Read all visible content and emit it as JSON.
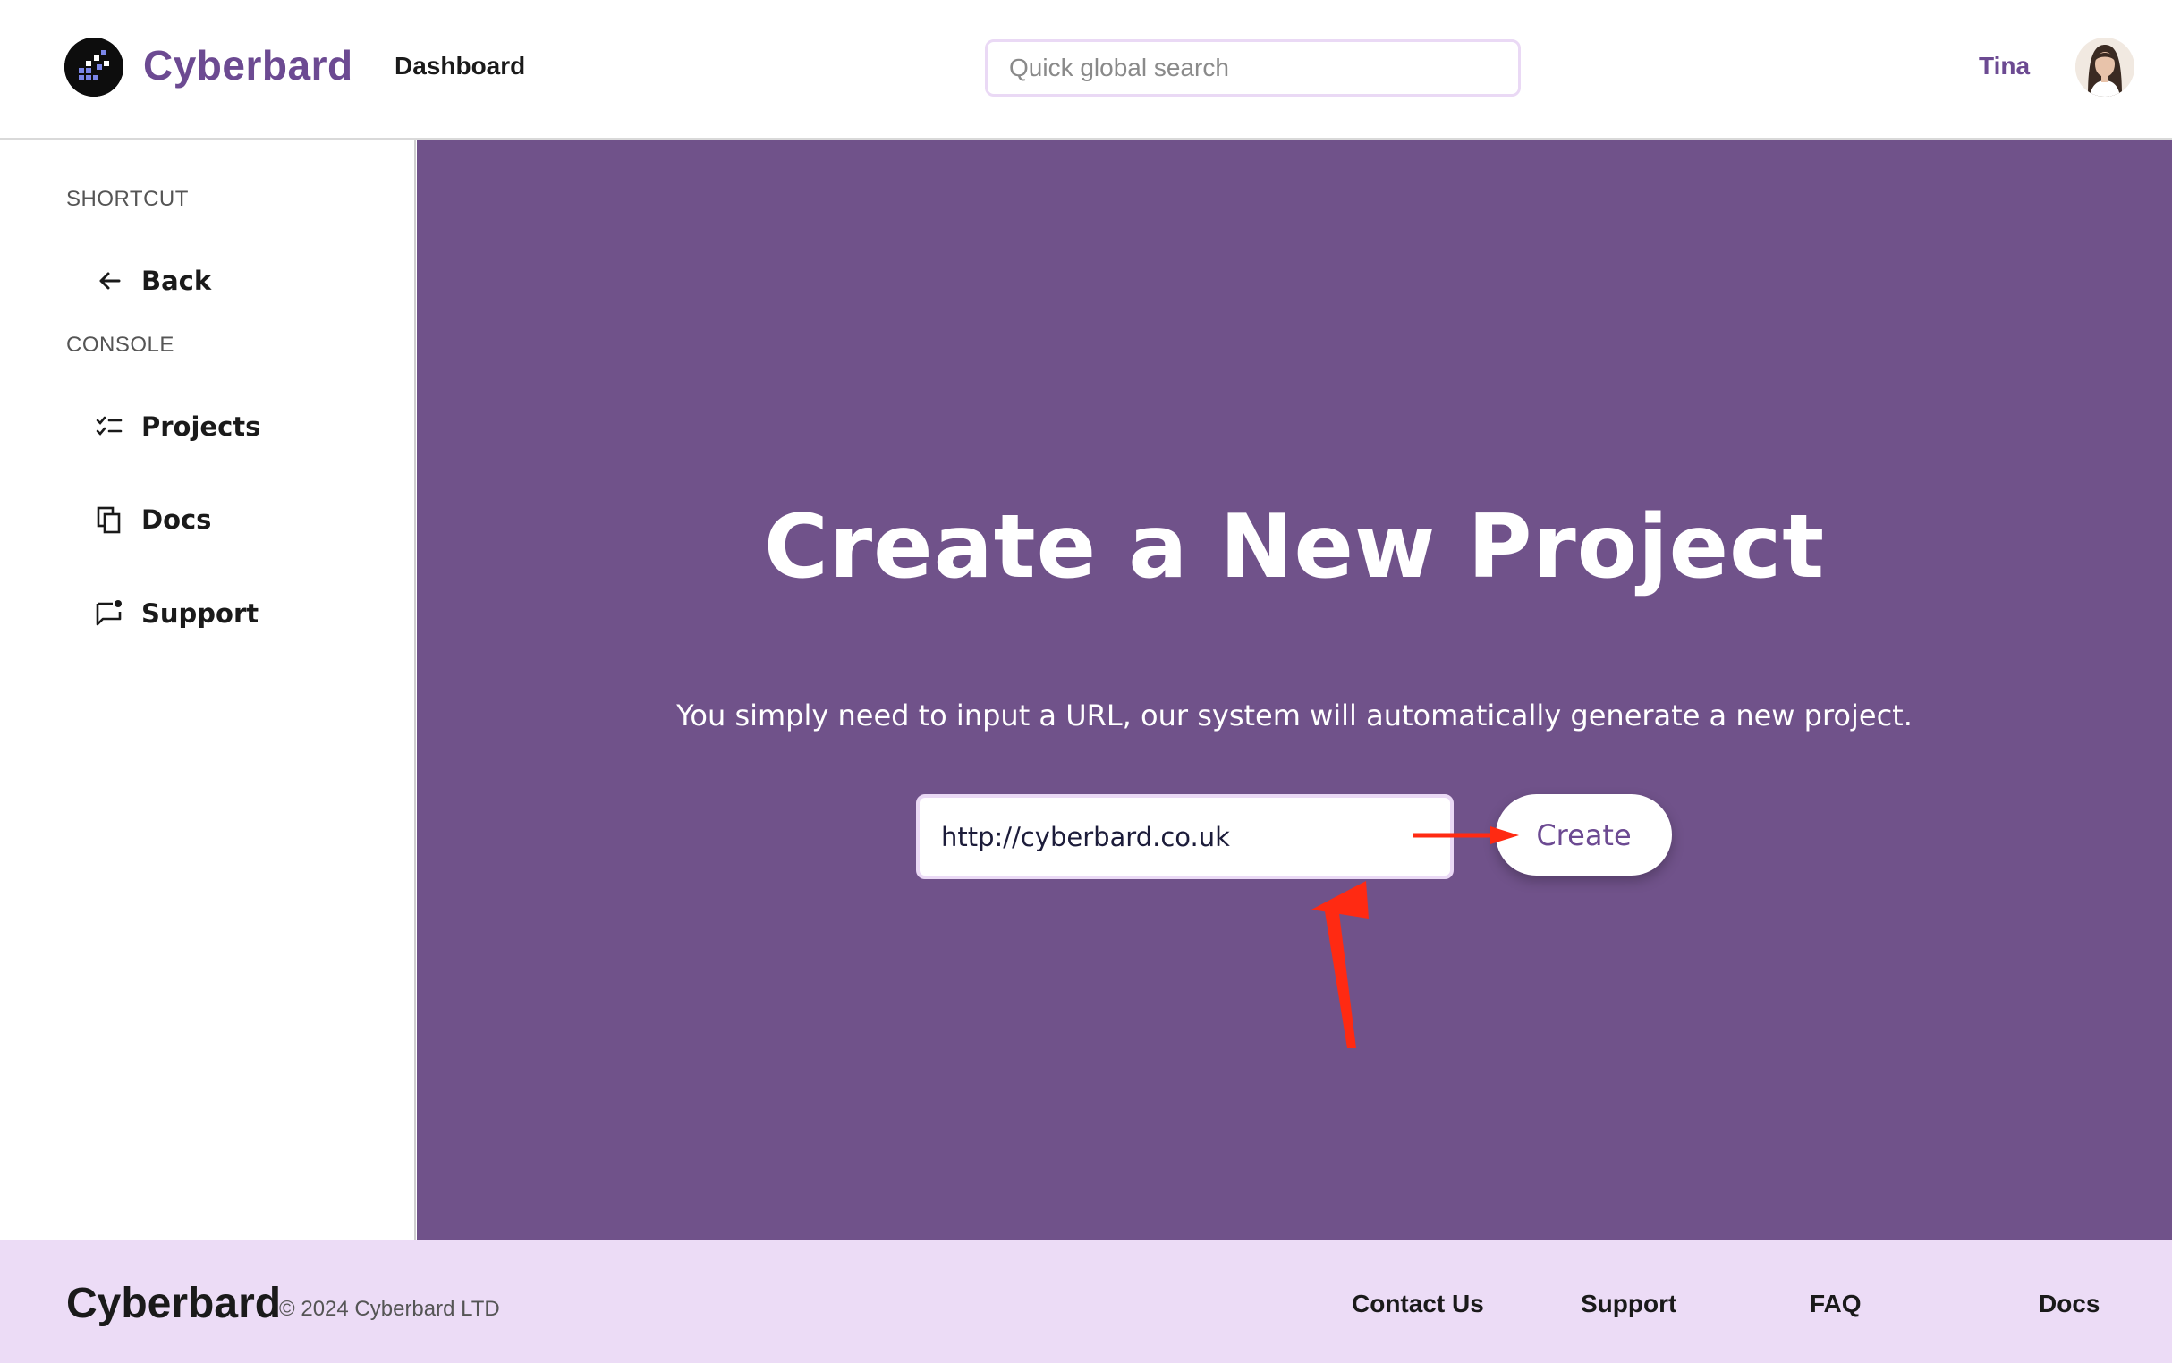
{
  "header": {
    "brand": "Cyberbard",
    "nav_dashboard": "Dashboard",
    "search_placeholder": "Quick global search",
    "username": "Tina"
  },
  "sidebar": {
    "shortcut_label": "SHORTCUT",
    "back_label": "Back",
    "console_label": "CONSOLE",
    "items": [
      {
        "label": "Projects",
        "icon": "checklist-icon"
      },
      {
        "label": "Docs",
        "icon": "copy-icon"
      },
      {
        "label": "Support",
        "icon": "chat-icon"
      }
    ]
  },
  "main": {
    "title": "Create a New Project",
    "subtitle": "You simply need to input a URL, our system will automatically generate a new project.",
    "url_value": "http://cyberbard.co.uk",
    "create_label": "Create"
  },
  "footer": {
    "brand": "Cyberbard",
    "copyright": "© 2024 Cyberbard LTD",
    "links": [
      "Contact Us",
      "Support",
      "FAQ",
      "Docs"
    ]
  },
  "colors": {
    "accent": "#6c4a92",
    "main_bg": "#70528a",
    "footer_bg": "#ecdcf6",
    "annotation": "#ff2a12"
  }
}
